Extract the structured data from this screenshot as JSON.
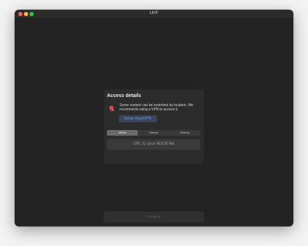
{
  "window": {
    "title": "UHF"
  },
  "panel": {
    "title": "Access details",
    "warning_text": "Some content can be restricted by location. We recommend using a VPN to access it.",
    "vpn_button_label": "Setup mygetVPN",
    "tabs": [
      {
        "label": "M3U8",
        "active": true
      },
      {
        "label": "Xtream",
        "active": false
      },
      {
        "label": "Stremio",
        "active": false
      }
    ],
    "url_placeholder": "URL to your M3U8 file"
  },
  "footer": {
    "continue_label": "Continue"
  },
  "colors": {
    "window_bg": "#232323",
    "panel_bg": "#2c2c2c",
    "accent_link": "#5a9dff",
    "warning_red": "#e5484d"
  },
  "icons": {
    "warning": "location-warning-icon",
    "close": "close-window-icon",
    "minimize": "minimize-window-icon",
    "maximize": "maximize-window-icon"
  }
}
